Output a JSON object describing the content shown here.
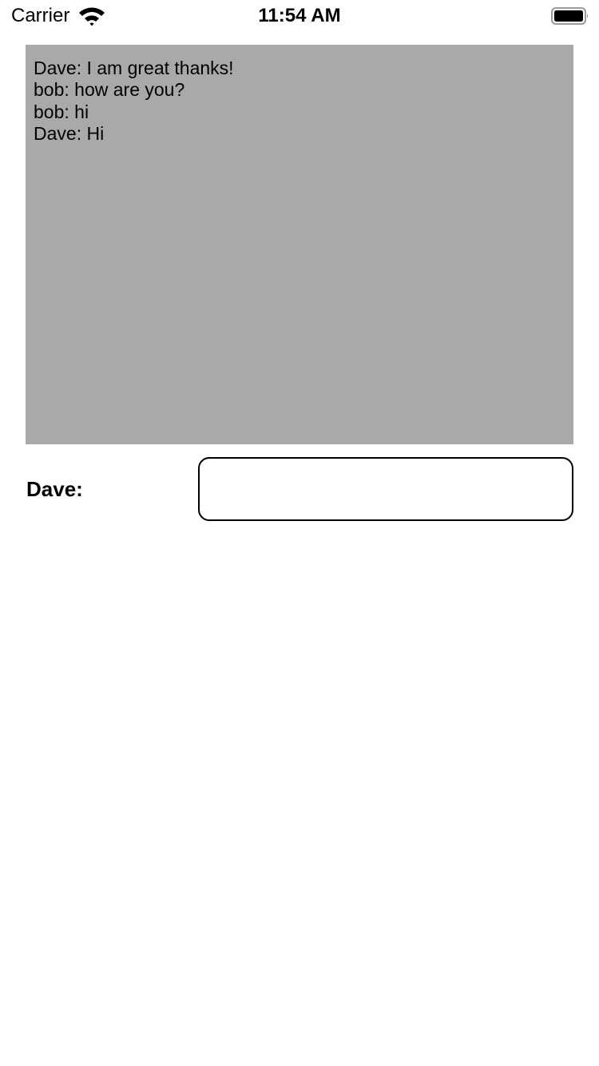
{
  "status_bar": {
    "carrier": "Carrier",
    "time": "11:54 AM",
    "wifi_icon": "wifi-icon",
    "battery_icon": "battery-full-icon"
  },
  "chat": {
    "background_color": "#a9a9a9",
    "messages": [
      "Dave: I am great thanks!",
      "bob: how are you?",
      "bob: hi",
      "Dave: Hi"
    ]
  },
  "compose": {
    "user_label": "Dave:",
    "input_value": "",
    "input_placeholder": ""
  }
}
